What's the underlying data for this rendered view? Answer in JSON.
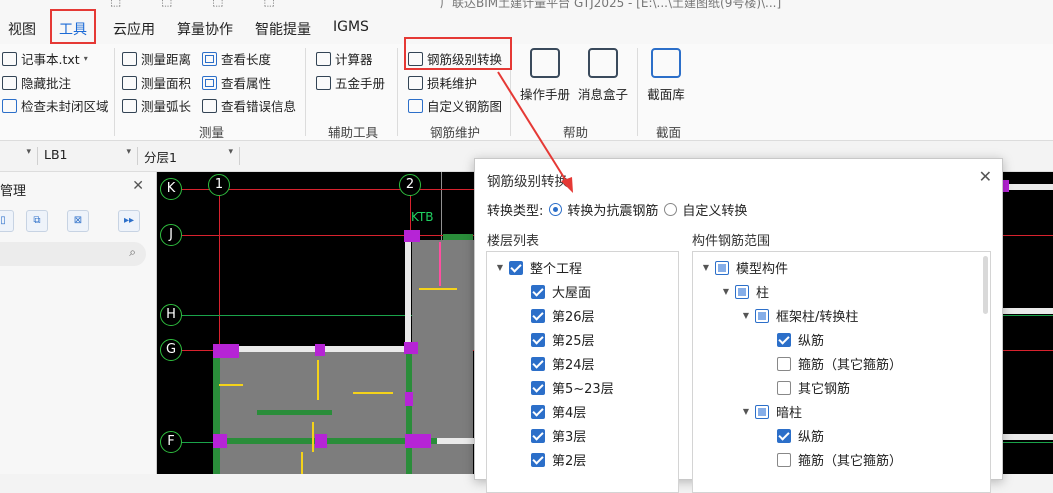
{
  "window": {
    "title": "广联达BIM土建计量平台 GTJ2025 - [E:\\...\\土建图纸(9号楼)\\...]"
  },
  "menubar": {
    "items": [
      "视图",
      "工具",
      "云应用",
      "算量协作",
      "智能提量",
      "IGMS"
    ],
    "active": "工具"
  },
  "ribbon": {
    "misc": {
      "notepad": "记事本.txt",
      "hide_comments": "隐藏批注",
      "check_unclosed": "检查未封闭区域"
    },
    "measure": {
      "group_label": "测量",
      "distance": "测量距离",
      "length": "查看长度",
      "area": "测量面积",
      "attributes": "查看属性",
      "arc": "测量弧长",
      "errors": "查看错误信息"
    },
    "aux": {
      "group_label": "辅助工具",
      "calculator": "计算器",
      "hardware": "五金手册"
    },
    "rebar": {
      "group_label": "钢筋维护",
      "grade_convert": "钢筋级别转换",
      "loss": "损耗维护",
      "custom": "自定义钢筋图"
    },
    "help": {
      "group_label": "帮助",
      "manual": "操作手册",
      "msgbox": "消息盒子"
    },
    "section": {
      "group_label": "截面",
      "library": "截面库"
    }
  },
  "selectors": {
    "component": "LB1",
    "layer": "分层1"
  },
  "left_panel": {
    "title": "管理",
    "search_icon": "search-icon"
  },
  "canvas": {
    "axes_h": [
      "K",
      "J",
      "H",
      "G",
      "F"
    ],
    "axes_v": [
      "1",
      "2"
    ],
    "labels": [
      "KTB"
    ]
  },
  "dialog": {
    "title": "钢筋级别转换",
    "convert_type_label": "转换类型:",
    "options": [
      "转换为抗震钢筋",
      "自定义转换"
    ],
    "selected_option": "转换为抗震钢筋",
    "floor_list_title": "楼层列表",
    "range_title": "构件钢筋范围",
    "floors": [
      {
        "label": "整个工程",
        "checked": true
      },
      {
        "label": "大屋面",
        "checked": true
      },
      {
        "label": "第26层",
        "checked": true
      },
      {
        "label": "第25层",
        "checked": true
      },
      {
        "label": "第24层",
        "checked": true
      },
      {
        "label": "第5~23层",
        "checked": true
      },
      {
        "label": "第4层",
        "checked": true
      },
      {
        "label": "第3层",
        "checked": true
      },
      {
        "label": "第2层",
        "checked": true
      }
    ],
    "range": [
      {
        "label": "模型构件",
        "state": "partial"
      },
      {
        "label": "柱",
        "state": "partial"
      },
      {
        "label": "框架柱/转换柱",
        "state": "partial"
      },
      {
        "label": "纵筋",
        "state": "checked"
      },
      {
        "label": "箍筋（其它箍筋）",
        "state": "unchecked"
      },
      {
        "label": "其它钢筋",
        "state": "unchecked"
      },
      {
        "label": "暗柱",
        "state": "partial"
      },
      {
        "label": "纵筋",
        "state": "checked"
      },
      {
        "label": "箍筋（其它箍筋）",
        "state": "unchecked"
      }
    ]
  },
  "colors": {
    "accent": "#2c6fc9",
    "highlight": "#e53935",
    "axis_green": "#2fbf3f"
  }
}
